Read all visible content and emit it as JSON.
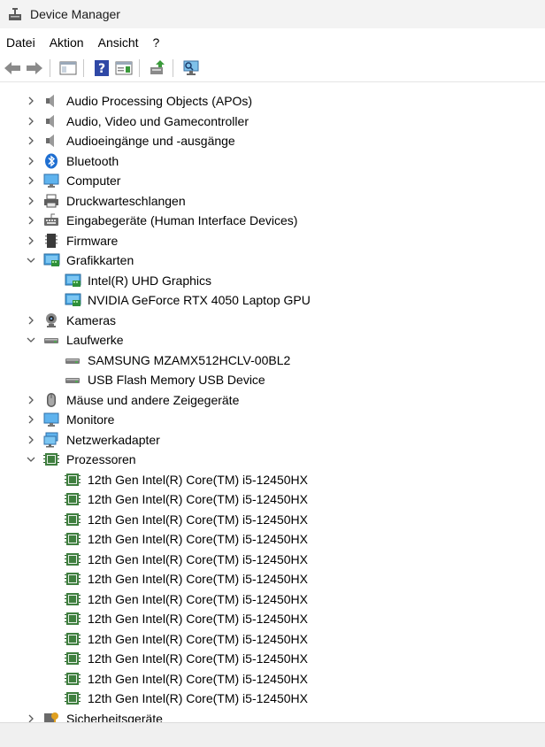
{
  "window": {
    "title": "Device Manager"
  },
  "menu": [
    "Datei",
    "Aktion",
    "Ansicht",
    "?"
  ],
  "toolbar": [
    "back-icon",
    "forward-icon",
    "show-hide-tree-icon",
    "help-icon",
    "properties-icon",
    "update-driver-icon",
    "scan-hardware-icon"
  ],
  "tree": [
    {
      "label": "Audio Processing Objects (APOs)",
      "level": 0,
      "expander": "collapsed",
      "icon": "speaker-icon"
    },
    {
      "label": "Audio, Video und Gamecontroller",
      "level": 0,
      "expander": "collapsed",
      "icon": "speaker-icon"
    },
    {
      "label": "Audioeingänge und -ausgänge",
      "level": 0,
      "expander": "collapsed",
      "icon": "speaker-icon"
    },
    {
      "label": "Bluetooth",
      "level": 0,
      "expander": "collapsed",
      "icon": "bluetooth-icon"
    },
    {
      "label": "Computer",
      "level": 0,
      "expander": "collapsed",
      "icon": "monitor-icon"
    },
    {
      "label": "Druckwarteschlangen",
      "level": 0,
      "expander": "collapsed",
      "icon": "printer-icon"
    },
    {
      "label": "Eingabegeräte (Human Interface Devices)",
      "level": 0,
      "expander": "collapsed",
      "icon": "hid-icon"
    },
    {
      "label": "Firmware",
      "level": 0,
      "expander": "collapsed",
      "icon": "firmware-icon"
    },
    {
      "label": "Grafikkarten",
      "level": 0,
      "expander": "expanded",
      "icon": "display-adapter-icon"
    },
    {
      "label": "Intel(R) UHD Graphics",
      "level": 1,
      "expander": "none",
      "icon": "display-adapter-icon"
    },
    {
      "label": "NVIDIA GeForce RTX 4050 Laptop GPU",
      "level": 1,
      "expander": "none",
      "icon": "display-adapter-icon"
    },
    {
      "label": "Kameras",
      "level": 0,
      "expander": "collapsed",
      "icon": "camera-icon"
    },
    {
      "label": "Laufwerke",
      "level": 0,
      "expander": "expanded",
      "icon": "disk-drive-icon"
    },
    {
      "label": "SAMSUNG MZAMX512HCLV-00BL2",
      "level": 1,
      "expander": "none",
      "icon": "disk-drive-icon"
    },
    {
      "label": "USB Flash Memory USB Device",
      "level": 1,
      "expander": "none",
      "icon": "disk-drive-icon"
    },
    {
      "label": "Mäuse und andere Zeigegeräte",
      "level": 0,
      "expander": "collapsed",
      "icon": "mouse-icon"
    },
    {
      "label": "Monitore",
      "level": 0,
      "expander": "collapsed",
      "icon": "monitor-icon"
    },
    {
      "label": "Netzwerkadapter",
      "level": 0,
      "expander": "collapsed",
      "icon": "network-adapter-icon"
    },
    {
      "label": "Prozessoren",
      "level": 0,
      "expander": "expanded",
      "icon": "processor-icon"
    },
    {
      "label": "12th Gen Intel(R) Core(TM) i5-12450HX",
      "level": 1,
      "expander": "none",
      "icon": "processor-icon"
    },
    {
      "label": "12th Gen Intel(R) Core(TM) i5-12450HX",
      "level": 1,
      "expander": "none",
      "icon": "processor-icon"
    },
    {
      "label": "12th Gen Intel(R) Core(TM) i5-12450HX",
      "level": 1,
      "expander": "none",
      "icon": "processor-icon"
    },
    {
      "label": "12th Gen Intel(R) Core(TM) i5-12450HX",
      "level": 1,
      "expander": "none",
      "icon": "processor-icon"
    },
    {
      "label": "12th Gen Intel(R) Core(TM) i5-12450HX",
      "level": 1,
      "expander": "none",
      "icon": "processor-icon"
    },
    {
      "label": "12th Gen Intel(R) Core(TM) i5-12450HX",
      "level": 1,
      "expander": "none",
      "icon": "processor-icon"
    },
    {
      "label": "12th Gen Intel(R) Core(TM) i5-12450HX",
      "level": 1,
      "expander": "none",
      "icon": "processor-icon"
    },
    {
      "label": "12th Gen Intel(R) Core(TM) i5-12450HX",
      "level": 1,
      "expander": "none",
      "icon": "processor-icon"
    },
    {
      "label": "12th Gen Intel(R) Core(TM) i5-12450HX",
      "level": 1,
      "expander": "none",
      "icon": "processor-icon"
    },
    {
      "label": "12th Gen Intel(R) Core(TM) i5-12450HX",
      "level": 1,
      "expander": "none",
      "icon": "processor-icon"
    },
    {
      "label": "12th Gen Intel(R) Core(TM) i5-12450HX",
      "level": 1,
      "expander": "none",
      "icon": "processor-icon"
    },
    {
      "label": "12th Gen Intel(R) Core(TM) i5-12450HX",
      "level": 1,
      "expander": "none",
      "icon": "processor-icon"
    },
    {
      "label": "Sicherheitsgeräte",
      "level": 0,
      "expander": "collapsed",
      "icon": "security-device-icon"
    }
  ]
}
